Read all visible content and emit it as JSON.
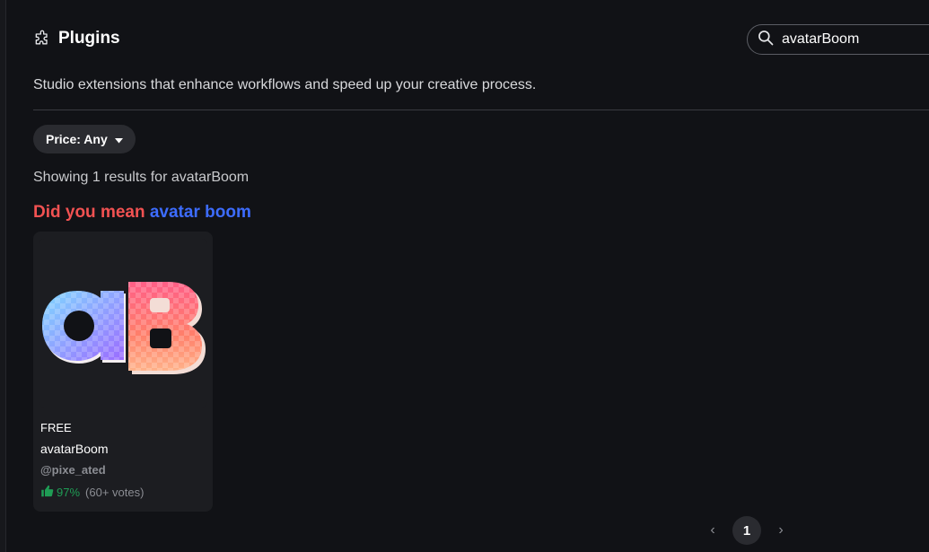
{
  "header": {
    "title": "Plugins",
    "icon": "puzzle-icon"
  },
  "search": {
    "value": "avatarBoom",
    "icon": "search-icon"
  },
  "subtitle": "Studio extensions that enhance workflows and speed up your creative process.",
  "filter": {
    "label": "Price: Any",
    "icon": "caret-down-icon"
  },
  "results": {
    "text": "Showing 1 results for avatarBoom"
  },
  "suggestion": {
    "label": "Did you mean",
    "term": "avatar boom"
  },
  "cards": [
    {
      "image_text": "aB",
      "price": "FREE",
      "name": "avatarBoom",
      "creator": "@pixe_ated",
      "rating_pct": "97%",
      "votes": "(60+ votes)",
      "rating_icon": "thumbs-up-icon"
    }
  ],
  "pagination": {
    "current": "1",
    "prev_icon": "chevron-left-icon",
    "next_icon": "chevron-right-icon"
  },
  "colors": {
    "accent_red": "#f25252",
    "accent_blue": "#3d6cff",
    "rating_green": "#1f9d55",
    "background": "#111216"
  }
}
